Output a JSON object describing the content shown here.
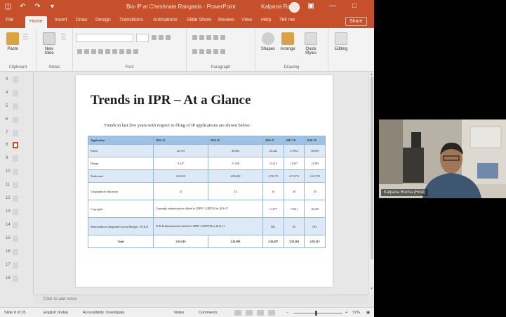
{
  "titlebar": {
    "document_title": "Bio-IP at Cheshnate Ranganis  -  PowerPoint",
    "user_name": "Kalpana Rocha"
  },
  "tabs": [
    {
      "label": "File"
    },
    {
      "label": "Home",
      "active": true
    },
    {
      "label": "Insert"
    },
    {
      "label": "Draw"
    },
    {
      "label": "Design"
    },
    {
      "label": "Transitions"
    },
    {
      "label": "Animations"
    },
    {
      "label": "Slide Show"
    },
    {
      "label": "Review"
    },
    {
      "label": "View"
    },
    {
      "label": "Help"
    },
    {
      "label": "Tell me"
    }
  ],
  "share_label": "Share",
  "ribbon": {
    "paste_label": "Paste",
    "new_slide_label": "New Slide",
    "shapes_label": "Shapes",
    "arrange_label": "Arrange",
    "quick_styles_label": "Quick Styles",
    "editing_label": "Editing",
    "groups": [
      "Clipboard",
      "Slides",
      "Font",
      "Paragraph",
      "Drawing"
    ]
  },
  "thumbnails": [
    {
      "num": "3"
    },
    {
      "num": "4"
    },
    {
      "num": "5"
    },
    {
      "num": "6"
    },
    {
      "num": "7"
    },
    {
      "num": "8",
      "active": true
    },
    {
      "num": "9"
    },
    {
      "num": "10"
    },
    {
      "num": "11"
    },
    {
      "num": "12"
    },
    {
      "num": "13"
    },
    {
      "num": "14"
    },
    {
      "num": "15"
    },
    {
      "num": "16"
    },
    {
      "num": "17"
    },
    {
      "num": "18"
    }
  ],
  "slide": {
    "title": "Trends in IPR – At a Glance",
    "subtitle": "Trends in last five years with respect to filing of IP applications are shown below:",
    "table": {
      "headers": [
        "Application",
        "2014-15",
        "2015-16",
        "2016-17",
        "2017-18",
        "2018-19"
      ],
      "rows": [
        {
          "name": "Patent",
          "cells": [
            "42,763",
            "46,904",
            "45,444",
            "47,854",
            "50,659"
          ],
          "shade": true
        },
        {
          "name": "Design",
          "cells": [
            "9,327",
            "11,108",
            "10,213",
            "11,837",
            "12,585"
          ],
          "shade": false
        },
        {
          "name": "Trade mark",
          "cells": [
            "2,10,501",
            "2,83,060",
            "2,78,170",
            "2,72,974",
            "3,23,798"
          ],
          "shade": true
        },
        {
          "name": "Geographical Indication",
          "cells": [
            "25",
            "14",
            "16",
            "38",
            "29"
          ],
          "shade": false
        },
        {
          "name": "Copyrights",
          "merged": "Copyright administration shifted to DIPP/ CGPDTM in 2016-17",
          "cells": [
            "14,677",
            "17,841",
            "16,229"
          ],
          "shade": false
        },
        {
          "name": "Semiconductor Integrated Layout Designs / SCILD",
          "merged": "SCILD administration shifted to DIPP/ CGPDTM in 2016-17",
          "cells": [
            "NIL",
            "03",
            "NIL"
          ],
          "shade": true
        },
        {
          "name": "Total",
          "cells": [
            "2,62,616",
            "3,41,096",
            "3,50,487",
            "3,50,504",
            "4,03,515"
          ],
          "shade": false,
          "total": true
        }
      ]
    }
  },
  "notes_placeholder": "Click to add notes",
  "status": {
    "slide_info": "Slide 8 of 35",
    "language": "English (India)",
    "accessibility": "Accessibility: Investigate",
    "notes": "Notes",
    "comments": "Comments",
    "zoom": "72%"
  },
  "webcam": {
    "caption": "Kalpana Rocha (Host)"
  },
  "colors": {
    "brand": "#c6502b",
    "table_header": "#9cc3e6",
    "table_shade": "#dde9f6"
  }
}
